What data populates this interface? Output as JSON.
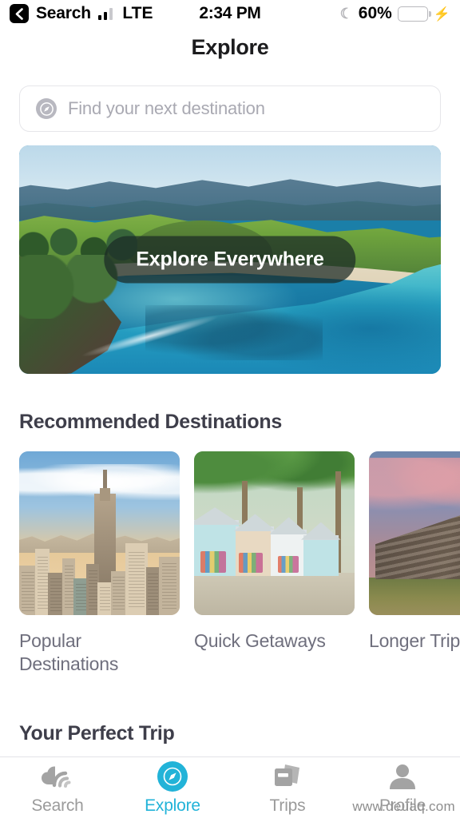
{
  "statusbar": {
    "back_label": "Search",
    "back_icon": "chevron-left-icon",
    "signal_icon": "cellular-signal-icon",
    "network": "LTE",
    "time": "2:34 PM",
    "dnd_icon": "moon-icon",
    "battery_percent": "60%",
    "battery_level": 60,
    "battery_icon": "battery-icon",
    "charging_icon": "lightning-bolt-icon"
  },
  "header": {
    "title": "Explore"
  },
  "search": {
    "icon": "compass-icon",
    "placeholder": "Find your next destination",
    "value": ""
  },
  "hero": {
    "cta_label": "Explore Everywhere",
    "image_alt": "aerial-coastline-beach"
  },
  "recommended": {
    "title": "Recommended Destinations",
    "cards": [
      {
        "label": "Popular Destinations",
        "image_alt": "new-york-city-skyline"
      },
      {
        "label": "Quick Getaways",
        "image_alt": "caribbean-village-shops"
      },
      {
        "label": "Longer Trips",
        "image_alt": "chichen-itza-pyramid"
      }
    ]
  },
  "perfect_trip": {
    "title": "Your Perfect Trip"
  },
  "tabbar": {
    "active_color": "#22b3d8",
    "inactive_color": "#9b9b9b",
    "tabs": [
      {
        "label": "Search",
        "icon": "cloud-signal-icon",
        "active": false
      },
      {
        "label": "Explore",
        "icon": "compass-icon",
        "active": true
      },
      {
        "label": "Trips",
        "icon": "cards-stack-icon",
        "active": false
      },
      {
        "label": "Profile",
        "icon": "person-icon",
        "active": false
      }
    ]
  },
  "watermark": {
    "text": "www.deuaq.com"
  }
}
